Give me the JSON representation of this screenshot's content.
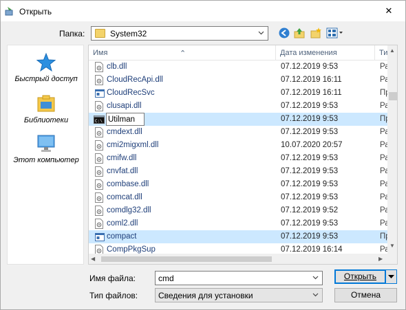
{
  "window": {
    "title": "Открыть",
    "close_glyph": "✕"
  },
  "toolbar": {
    "folder_label": "Папка:",
    "folder_value": "System32",
    "icons": [
      "back-icon",
      "up-folder-icon",
      "new-folder-icon",
      "view-menu-icon"
    ]
  },
  "places": [
    {
      "label": "Быстрый доступ",
      "icon": "quick-access-star-icon"
    },
    {
      "label": "Библиотеки",
      "icon": "libraries-icon"
    },
    {
      "label": "Этот компьютер",
      "icon": "this-pc-icon"
    }
  ],
  "columns": {
    "name": "Имя",
    "date": "Дата изменения",
    "type": "Ти"
  },
  "files": [
    {
      "name": "clb.dll",
      "date": "07.12.2019 9:53",
      "type": "Ра",
      "kind": "dll"
    },
    {
      "name": "CloudRecApi.dll",
      "date": "07.12.2019 16:11",
      "type": "Ра",
      "kind": "dll"
    },
    {
      "name": "CloudRecSvc",
      "date": "07.12.2019 16:11",
      "type": "Пр",
      "kind": "exe"
    },
    {
      "name": "clusapi.dll",
      "date": "07.12.2019 9:53",
      "type": "Ра",
      "kind": "dll"
    },
    {
      "name": "Utilman",
      "date": "07.12.2019 9:53",
      "type": "Пр",
      "kind": "cmd",
      "renaming": true,
      "selected": true
    },
    {
      "name": "cmdext.dll",
      "date": "07.12.2019 9:53",
      "type": "Ра",
      "kind": "dll"
    },
    {
      "name": "cmi2migxml.dll",
      "date": "10.07.2020 20:57",
      "type": "Ра",
      "kind": "dll"
    },
    {
      "name": "cmifw.dll",
      "date": "07.12.2019 9:53",
      "type": "Ра",
      "kind": "dll"
    },
    {
      "name": "cnvfat.dll",
      "date": "07.12.2019 9:53",
      "type": "Ра",
      "kind": "dll"
    },
    {
      "name": "combase.dll",
      "date": "07.12.2019 9:53",
      "type": "Ра",
      "kind": "dll"
    },
    {
      "name": "comcat.dll",
      "date": "07.12.2019 9:53",
      "type": "Ра",
      "kind": "dll"
    },
    {
      "name": "comdlg32.dll",
      "date": "07.12.2019 9:52",
      "type": "Ра",
      "kind": "dll"
    },
    {
      "name": "coml2.dll",
      "date": "07.12.2019 9:53",
      "type": "Ра",
      "kind": "dll"
    },
    {
      "name": "compact",
      "date": "07.12.2019 9:53",
      "type": "Пр",
      "kind": "exe",
      "selected": true
    },
    {
      "name": "CompPkgSup",
      "date": "07.12.2019 16:14",
      "type": "Ра",
      "kind": "dll"
    }
  ],
  "bottom": {
    "filename_label": "Имя файла:",
    "filename_value": "cmd",
    "filetype_label": "Тип файлов:",
    "filetype_value": "Сведения для установки",
    "open_button": "Открыть",
    "cancel_button": "Отмена"
  },
  "colors": {
    "selection": "#cce8ff",
    "accent": "#0078d7",
    "link_text": "#1e3e79"
  }
}
